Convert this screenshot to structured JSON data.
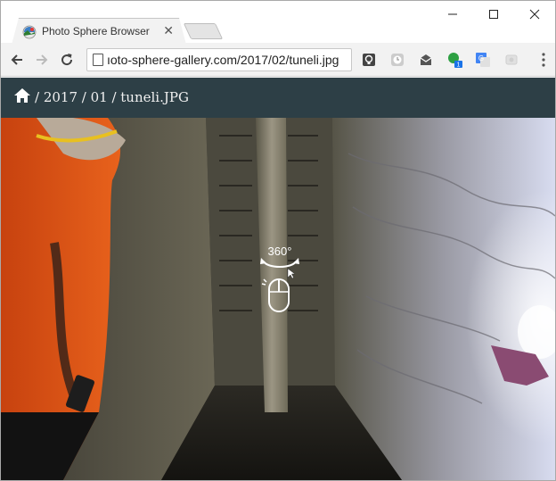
{
  "tab": {
    "title": "Photo Sphere Browser",
    "close_glyph": "✕"
  },
  "window_controls": {
    "minimize_glyph": "—",
    "maximize_glyph": "☐",
    "close_glyph": "✕"
  },
  "toolbar": {
    "url": "ıoto-sphere-gallery.com/2017/02/tuneli.jpg"
  },
  "header": {
    "breadcrumb": "/ 2017 / 01 / tuneli.JPG"
  },
  "viewer": {
    "hint_text": "360°"
  },
  "icons": {
    "back": "back-arrow-icon",
    "forward": "forward-arrow-icon",
    "reload": "reload-icon",
    "home": "home-icon",
    "menu": "more-vert-icon"
  },
  "colors": {
    "header_bg": "#2d3f46",
    "toolbar_bg": "#f2f2f2"
  }
}
